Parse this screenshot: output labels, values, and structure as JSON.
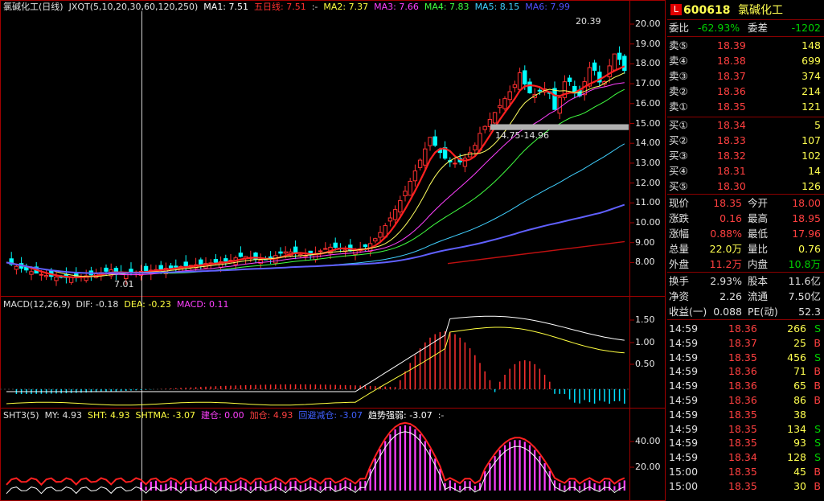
{
  "main_legend": {
    "items": [
      {
        "text": "氯碱化工(日线)",
        "color": "#e0e0e0"
      },
      {
        "text": "JXQT(5,10,20,30,60,120,250)",
        "color": "#e0e0e0"
      },
      {
        "text": "MA1: 7.51",
        "color": "#ffffff"
      },
      {
        "text": "五日线: 7.51",
        "color": "#ff3030"
      },
      {
        "text": ":-",
        "color": "#e0e0e0"
      },
      {
        "text": "MA2: 7.37",
        "color": "#ffff40"
      },
      {
        "text": "MA3: 7.66",
        "color": "#ff40ff"
      },
      {
        "text": "MA4: 7.83",
        "color": "#40ff40"
      },
      {
        "text": "MA5: 8.15",
        "color": "#40d0ff"
      },
      {
        "text": "MA6: 7.99",
        "color": "#5050ff"
      }
    ]
  },
  "main_axis": [
    "20.00",
    "19.00",
    "18.00",
    "17.00",
    "16.00",
    "15.00",
    "14.00",
    "13.00",
    "12.00",
    "11.00",
    "10.00",
    "9.00",
    "8.00"
  ],
  "annotations": {
    "high": "20.39",
    "low": "7.01",
    "gap": "14.75-14.96"
  },
  "macd_legend": {
    "items": [
      {
        "text": "MACD(12,26,9)",
        "color": "#e0e0e0"
      },
      {
        "text": "DIF: -0.18",
        "color": "#e0e0e0"
      },
      {
        "text": "DEA: -0.23",
        "color": "#ffff40"
      },
      {
        "text": "MACD: 0.11",
        "color": "#ff40ff"
      }
    ]
  },
  "macd_axis": [
    "1.50",
    "1.00",
    "0.50"
  ],
  "sht_legend": {
    "items": [
      {
        "text": "SHT3(5)",
        "color": "#e0e0e0"
      },
      {
        "text": "MY: 4.93",
        "color": "#e0e0e0"
      },
      {
        "text": "SHT: 4.93",
        "color": "#ffff40"
      },
      {
        "text": "SHTMA: -3.07",
        "color": "#ffff40"
      },
      {
        "text": "建仓: 0.00",
        "color": "#ff40ff"
      },
      {
        "text": "加仓: 4.93",
        "color": "#ff4040"
      },
      {
        "text": "回避减仓: -3.07",
        "color": "#4060ff"
      },
      {
        "text": "趋势强弱: -3.07",
        "color": "#ffffff"
      },
      {
        "text": ":-",
        "color": "#e0e0e0"
      }
    ]
  },
  "sht_axis": [
    "40.00",
    "20.00"
  ],
  "chart_data": [
    {
      "type": "candlestick",
      "title": "氯碱化工(日线)",
      "ylim": [
        7.0,
        20.5
      ],
      "series": [
        {
          "name": "MA2",
          "values": [
            7.37,
            18.3
          ]
        },
        {
          "name": "MA3",
          "values": [
            7.66,
            17.8
          ]
        },
        {
          "name": "MA4",
          "values": [
            7.83,
            16.7
          ]
        },
        {
          "name": "MA5",
          "values": [
            8.15,
            13.7
          ]
        },
        {
          "name": "MA6",
          "values": [
            7.99,
            10.9
          ]
        }
      ]
    },
    {
      "type": "bar",
      "title": "MACD(12,26,9)",
      "ylim": [
        -0.5,
        1.7
      ]
    },
    {
      "type": "bar",
      "title": "SHT3(5)",
      "ylim": [
        0,
        60
      ]
    }
  ],
  "quote": {
    "code": "600618",
    "name": "氯碱化工",
    "weibi_label": "委比",
    "weibi": "-62.93%",
    "weicha_label": "委差",
    "weicha": "-1202",
    "asks": [
      {
        "label": "卖⑤",
        "price": "18.39",
        "vol": "148"
      },
      {
        "label": "卖④",
        "price": "18.38",
        "vol": "699"
      },
      {
        "label": "卖③",
        "price": "18.37",
        "vol": "374"
      },
      {
        "label": "卖②",
        "price": "18.36",
        "vol": "214"
      },
      {
        "label": "卖①",
        "price": "18.35",
        "vol": "121"
      }
    ],
    "bids": [
      {
        "label": "买①",
        "price": "18.34",
        "vol": "5"
      },
      {
        "label": "买②",
        "price": "18.33",
        "vol": "107"
      },
      {
        "label": "买③",
        "price": "18.32",
        "vol": "102"
      },
      {
        "label": "买④",
        "price": "18.31",
        "vol": "14"
      },
      {
        "label": "买⑤",
        "price": "18.30",
        "vol": "126"
      }
    ],
    "stats": [
      {
        "l1": "现价",
        "v1": "18.35",
        "c1": "red",
        "l2": "今开",
        "v2": "18.00",
        "c2": "red"
      },
      {
        "l1": "涨跌",
        "v1": "0.16",
        "c1": "red",
        "l2": "最高",
        "v2": "18.95",
        "c2": "red"
      },
      {
        "l1": "涨幅",
        "v1": "0.88%",
        "c1": "red",
        "l2": "最低",
        "v2": "17.96",
        "c2": "red"
      },
      {
        "l1": "总量",
        "v1": "22.0万",
        "c1": "yellow",
        "l2": "量比",
        "v2": "0.76",
        "c2": "yellow"
      },
      {
        "l1": "外盘",
        "v1": "11.2万",
        "c1": "red",
        "l2": "内盘",
        "v2": "10.8万",
        "c2": "green"
      }
    ],
    "stats2": [
      {
        "l1": "换手",
        "v1": "2.93%",
        "c1": "white",
        "l2": "股本",
        "v2": "11.6亿",
        "c2": "white"
      },
      {
        "l1": "净资",
        "v1": "2.26",
        "c1": "white",
        "l2": "流通",
        "v2": "7.50亿",
        "c2": "white"
      },
      {
        "l1": "收益(一)",
        "v1": "0.088",
        "c1": "white",
        "l2": "PE(动)",
        "v2": "52.3",
        "c2": "white"
      }
    ],
    "ticks": [
      {
        "time": "14:59",
        "price": "18.36",
        "vol": "266",
        "dir": "S"
      },
      {
        "time": "14:59",
        "price": "18.37",
        "vol": "25",
        "dir": "B"
      },
      {
        "time": "14:59",
        "price": "18.35",
        "vol": "456",
        "dir": "S"
      },
      {
        "time": "14:59",
        "price": "18.36",
        "vol": "71",
        "dir": "B"
      },
      {
        "time": "14:59",
        "price": "18.36",
        "vol": "65",
        "dir": "B"
      },
      {
        "time": "14:59",
        "price": "18.36",
        "vol": "86",
        "dir": "B"
      },
      {
        "time": "14:59",
        "price": "18.35",
        "vol": "38",
        "dir": ""
      },
      {
        "time": "14:59",
        "price": "18.35",
        "vol": "134",
        "dir": "S"
      },
      {
        "time": "14:59",
        "price": "18.35",
        "vol": "93",
        "dir": "S"
      },
      {
        "time": "14:59",
        "price": "18.34",
        "vol": "128",
        "dir": "S"
      },
      {
        "time": "15:00",
        "price": "18.35",
        "vol": "45",
        "dir": "B"
      },
      {
        "time": "15:00",
        "price": "18.35",
        "vol": "30",
        "dir": "B"
      }
    ]
  }
}
